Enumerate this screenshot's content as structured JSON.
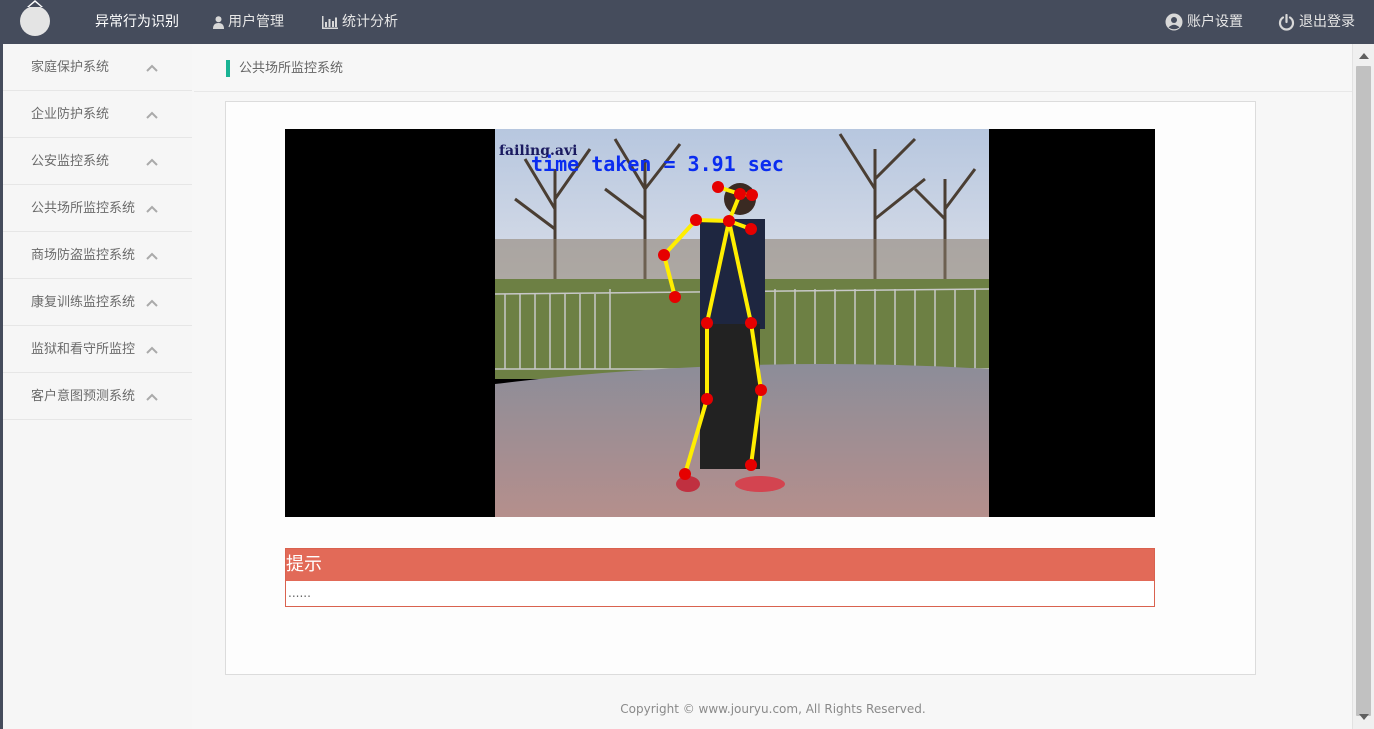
{
  "nav": {
    "items": [
      {
        "label": "异常行为识别",
        "icon": ""
      },
      {
        "label": "用户管理",
        "icon": "user-icon"
      },
      {
        "label": "统计分析",
        "icon": "bar-chart-icon"
      }
    ],
    "account": {
      "label": "账户设置",
      "icon": "user-circle-icon"
    },
    "logout": {
      "label": "退出登录",
      "icon": "power-icon"
    }
  },
  "sidebar": {
    "items": [
      {
        "label": "家庭保护系统"
      },
      {
        "label": "企业防护系统"
      },
      {
        "label": "公安监控系统"
      },
      {
        "label": "公共场所监控系统"
      },
      {
        "label": "商场防盗监控系统"
      },
      {
        "label": "康复训练监控系统"
      },
      {
        "label": "监狱和看守所监控"
      },
      {
        "label": "客户意图预测系统"
      }
    ]
  },
  "breadcrumb": "公共场所监控系统",
  "video": {
    "filename": "failing.avi",
    "overlay_text": "time taken = 3.91 sec"
  },
  "tip": {
    "title": "提示",
    "body": "......"
  },
  "footer": {
    "copyright": "Copyright © www.jouryu.com, All Rights Reserved."
  },
  "colors": {
    "topbar": "#454c5c",
    "accent": "#1ab394",
    "tip": "#e26a58",
    "skeleton_line": "#ffee00",
    "skeleton_joint": "#e60000"
  }
}
